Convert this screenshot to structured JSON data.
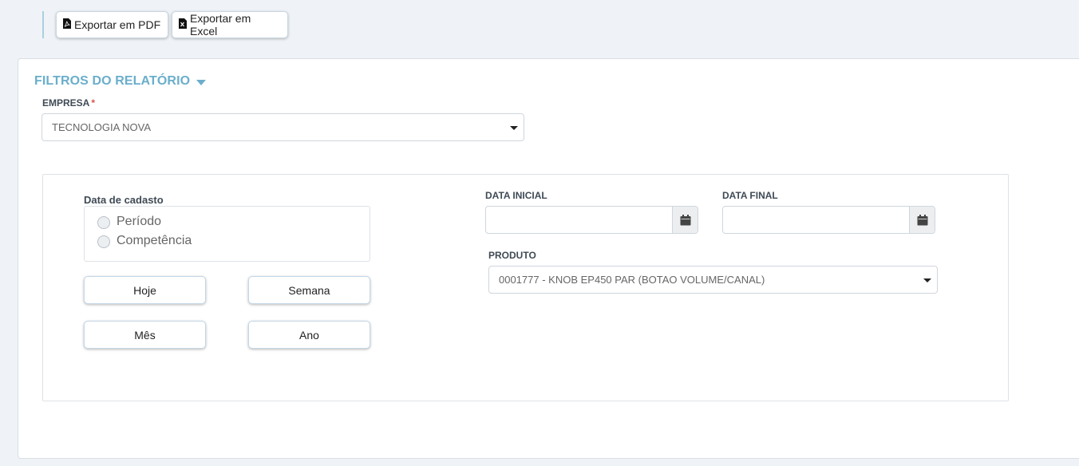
{
  "toolbar": {
    "export_pdf_label": "Exportar em PDF",
    "export_excel_label": "Exportar em Excel"
  },
  "filters": {
    "title": "FILTROS DO RELATÓRIO",
    "empresa": {
      "label": "EMPRESA",
      "required_mark": "*",
      "value": "TECNOLOGIA NOVA"
    },
    "data_cadastro": {
      "label": "Data de cadasto",
      "options": [
        "Período",
        "Competência"
      ]
    },
    "period_buttons": {
      "today": "Hoje",
      "week": "Semana",
      "month": "Mês",
      "year": "Ano"
    },
    "data_inicial": {
      "label": "DATA INICIAL",
      "value": ""
    },
    "data_final": {
      "label": "DATA FINAL",
      "value": ""
    },
    "produto": {
      "label": "PRODUTO",
      "value": "0001777 - KNOB EP450 PAR (BOTAO VOLUME/CANAL)"
    }
  },
  "icons": {
    "pdf": "file-pdf-icon",
    "excel": "file-excel-icon",
    "calendar": "calendar-icon",
    "collapse": "caret-down-icon"
  },
  "colors": {
    "accent": "#6aaecb",
    "background": "#eff3f7",
    "required": "#d9534f"
  }
}
